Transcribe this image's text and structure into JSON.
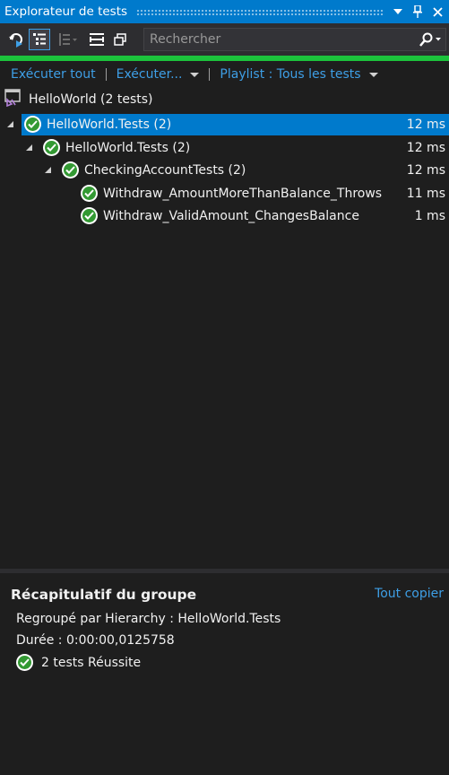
{
  "window": {
    "title": "Explorateur de tests",
    "accent": "#007acc"
  },
  "toolbar": {
    "icons": [
      "run-refresh-icon",
      "hierarchy-view-icon",
      "group-by-icon",
      "expand-all-icon",
      "copy-window-icon"
    ],
    "search_placeholder": "Rechercher"
  },
  "progress": {
    "fraction": 1.0,
    "color": "#1cc33c"
  },
  "commands": {
    "run_all": "Exécuter tout",
    "run": "Exécuter...",
    "playlist": "Playlist : Tous les tests"
  },
  "project": {
    "label": "HelloWorld (2 tests)"
  },
  "tree": [
    {
      "label": "HelloWorld.Tests (2)",
      "duration": "12 ms",
      "depth": 0,
      "expander": true,
      "selected": true
    },
    {
      "label": "HelloWorld.Tests (2)",
      "duration": "12 ms",
      "depth": 1,
      "expander": true,
      "selected": false
    },
    {
      "label": "CheckingAccountTests (2)",
      "duration": "12 ms",
      "depth": 2,
      "expander": true,
      "selected": false
    },
    {
      "label": "Withdraw_AmountMoreThanBalance_Throws",
      "duration": "11 ms",
      "depth": 3,
      "expander": false,
      "selected": false
    },
    {
      "label": "Withdraw_ValidAmount_ChangesBalance",
      "duration": "1 ms",
      "depth": 3,
      "expander": false,
      "selected": false
    }
  ],
  "summary": {
    "title": "Récapitulatif du groupe",
    "copy_all": "Tout copier",
    "grouped_by": "Regroupé par Hierarchy : HelloWorld.Tests",
    "duration": "Durée : 0:00:00,0125758",
    "result": "2 tests Réussite"
  }
}
